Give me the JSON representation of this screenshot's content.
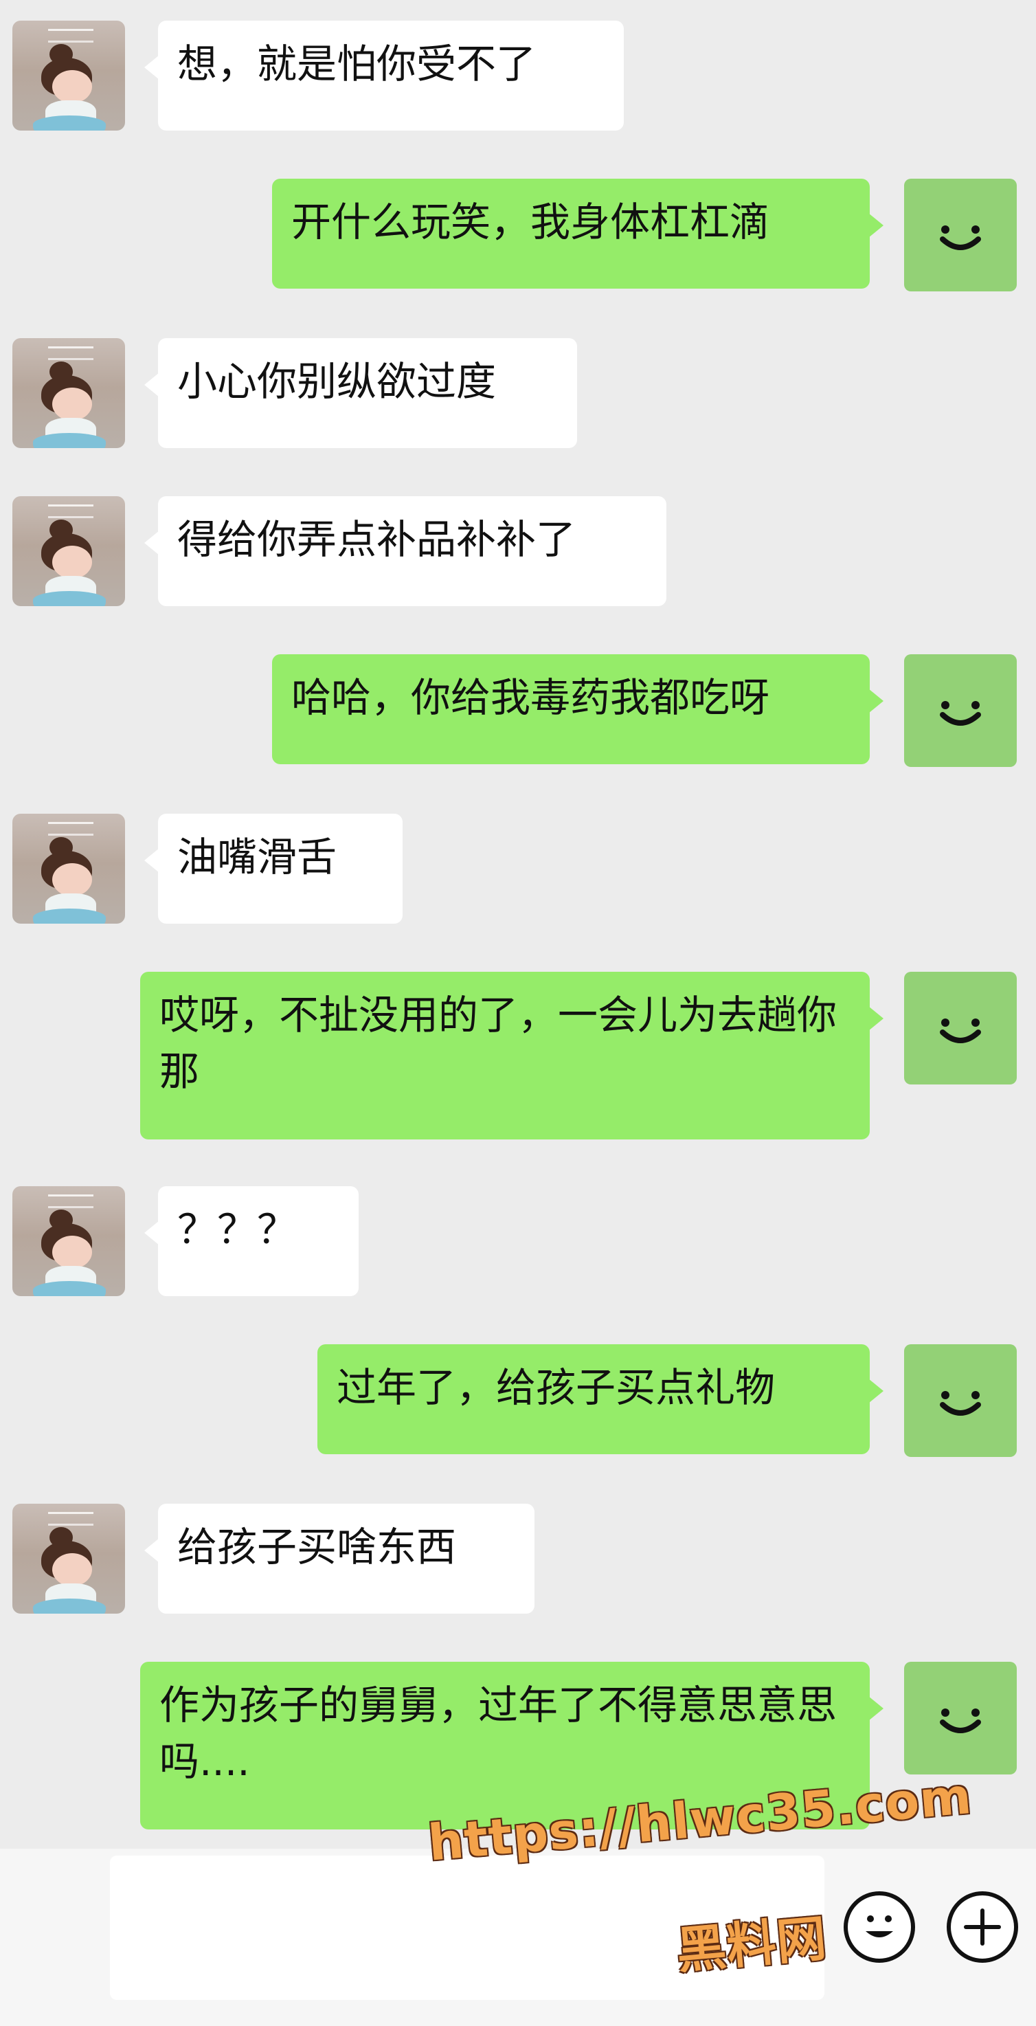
{
  "messages": [
    {
      "side": "left",
      "text": "想，就是怕你受不了"
    },
    {
      "side": "right",
      "text": "开什么玩笑，我身体杠杠滴"
    },
    {
      "side": "left",
      "text": "小心你别纵欲过度"
    },
    {
      "side": "left",
      "text": "得给你弄点补品补补了"
    },
    {
      "side": "right",
      "text": "哈哈，你给我毒药我都吃呀"
    },
    {
      "side": "left",
      "text": "油嘴滑舌"
    },
    {
      "side": "right",
      "text": "哎呀，不扯没用的了，一会儿为去趟你那"
    },
    {
      "side": "left",
      "text": "？？？"
    },
    {
      "side": "right",
      "text": "过年了，给孩子买点礼物"
    },
    {
      "side": "left",
      "text": "给孩子买啥东西"
    },
    {
      "side": "right",
      "text": "作为孩子的舅舅，过年了不得意思意思吗...."
    }
  ],
  "watermark": {
    "url": "https://hlwc35.com",
    "name": "黑料网"
  },
  "icons": {
    "contact_avatar": "avatar-girl",
    "self_avatar": "smile-face-icon",
    "emoji_button": "emoji-icon",
    "plus_button": "plus-icon"
  },
  "colors": {
    "background": "#ececec",
    "left_bubble": "#ffffff",
    "right_bubble": "#95ec69",
    "self_avatar_bg": "#93d176",
    "watermark": "#f3a24a"
  }
}
